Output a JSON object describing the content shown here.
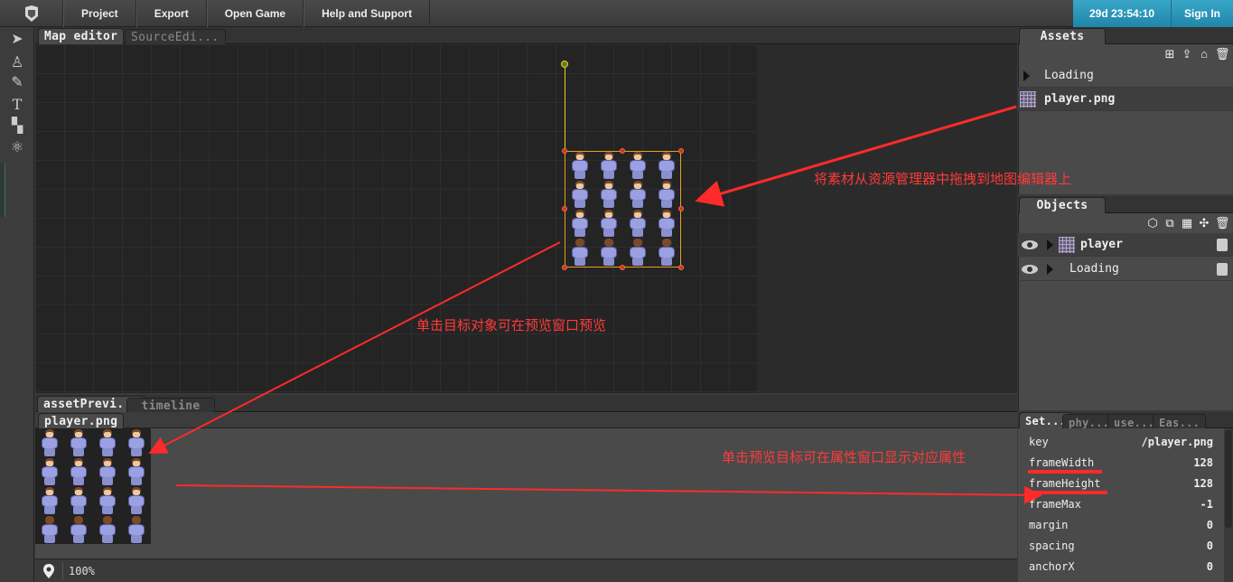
{
  "menu": {
    "items": [
      "Project",
      "Export",
      "Open Game",
      "Help and Support"
    ],
    "timer": "29d 23:54:10",
    "signin": "Sign In"
  },
  "editor_tabs": [
    "Map editor",
    "SourceEdi..."
  ],
  "preview_tabs": [
    "assetPrevi...",
    "timeline"
  ],
  "preview_subtab": "player.png",
  "status": {
    "zoom": "100%"
  },
  "assets": {
    "title": "Assets",
    "icons": [
      "add-icon",
      "upload-icon",
      "import-icon",
      "delete-icon"
    ],
    "items": [
      {
        "label": "Loading",
        "type": "folder"
      },
      {
        "label": "player.png",
        "type": "image"
      }
    ]
  },
  "objects": {
    "title": "Objects",
    "icons": [
      "cube-icon",
      "copy-icon",
      "grid-icon",
      "group-icon",
      "delete-icon"
    ],
    "items": [
      {
        "label": "player",
        "type": "sprite"
      },
      {
        "label": "Loading",
        "type": "group"
      }
    ]
  },
  "props_tabs": [
    "Set...",
    "phy...",
    "use...",
    "Eas..."
  ],
  "props": [
    {
      "key": "key",
      "value": "/player.png"
    },
    {
      "key": "frameWidth",
      "value": "128"
    },
    {
      "key": "frameHeight",
      "value": "128"
    },
    {
      "key": "frameMax",
      "value": "-1"
    },
    {
      "key": "margin",
      "value": "0"
    },
    {
      "key": "spacing",
      "value": "0"
    },
    {
      "key": "anchorX",
      "value": "0"
    }
  ],
  "annotations": {
    "drag": "将素材从资源管理器中拖拽到地图编辑器上",
    "click_preview": "单击目标对象可在预览窗口预览",
    "click_props": "单击预览目标可在属性窗口显示对应属性"
  },
  "colors": {
    "accent": "#2a9cc0",
    "annotation": "#ff3a3a",
    "selection": "#e8a020"
  }
}
